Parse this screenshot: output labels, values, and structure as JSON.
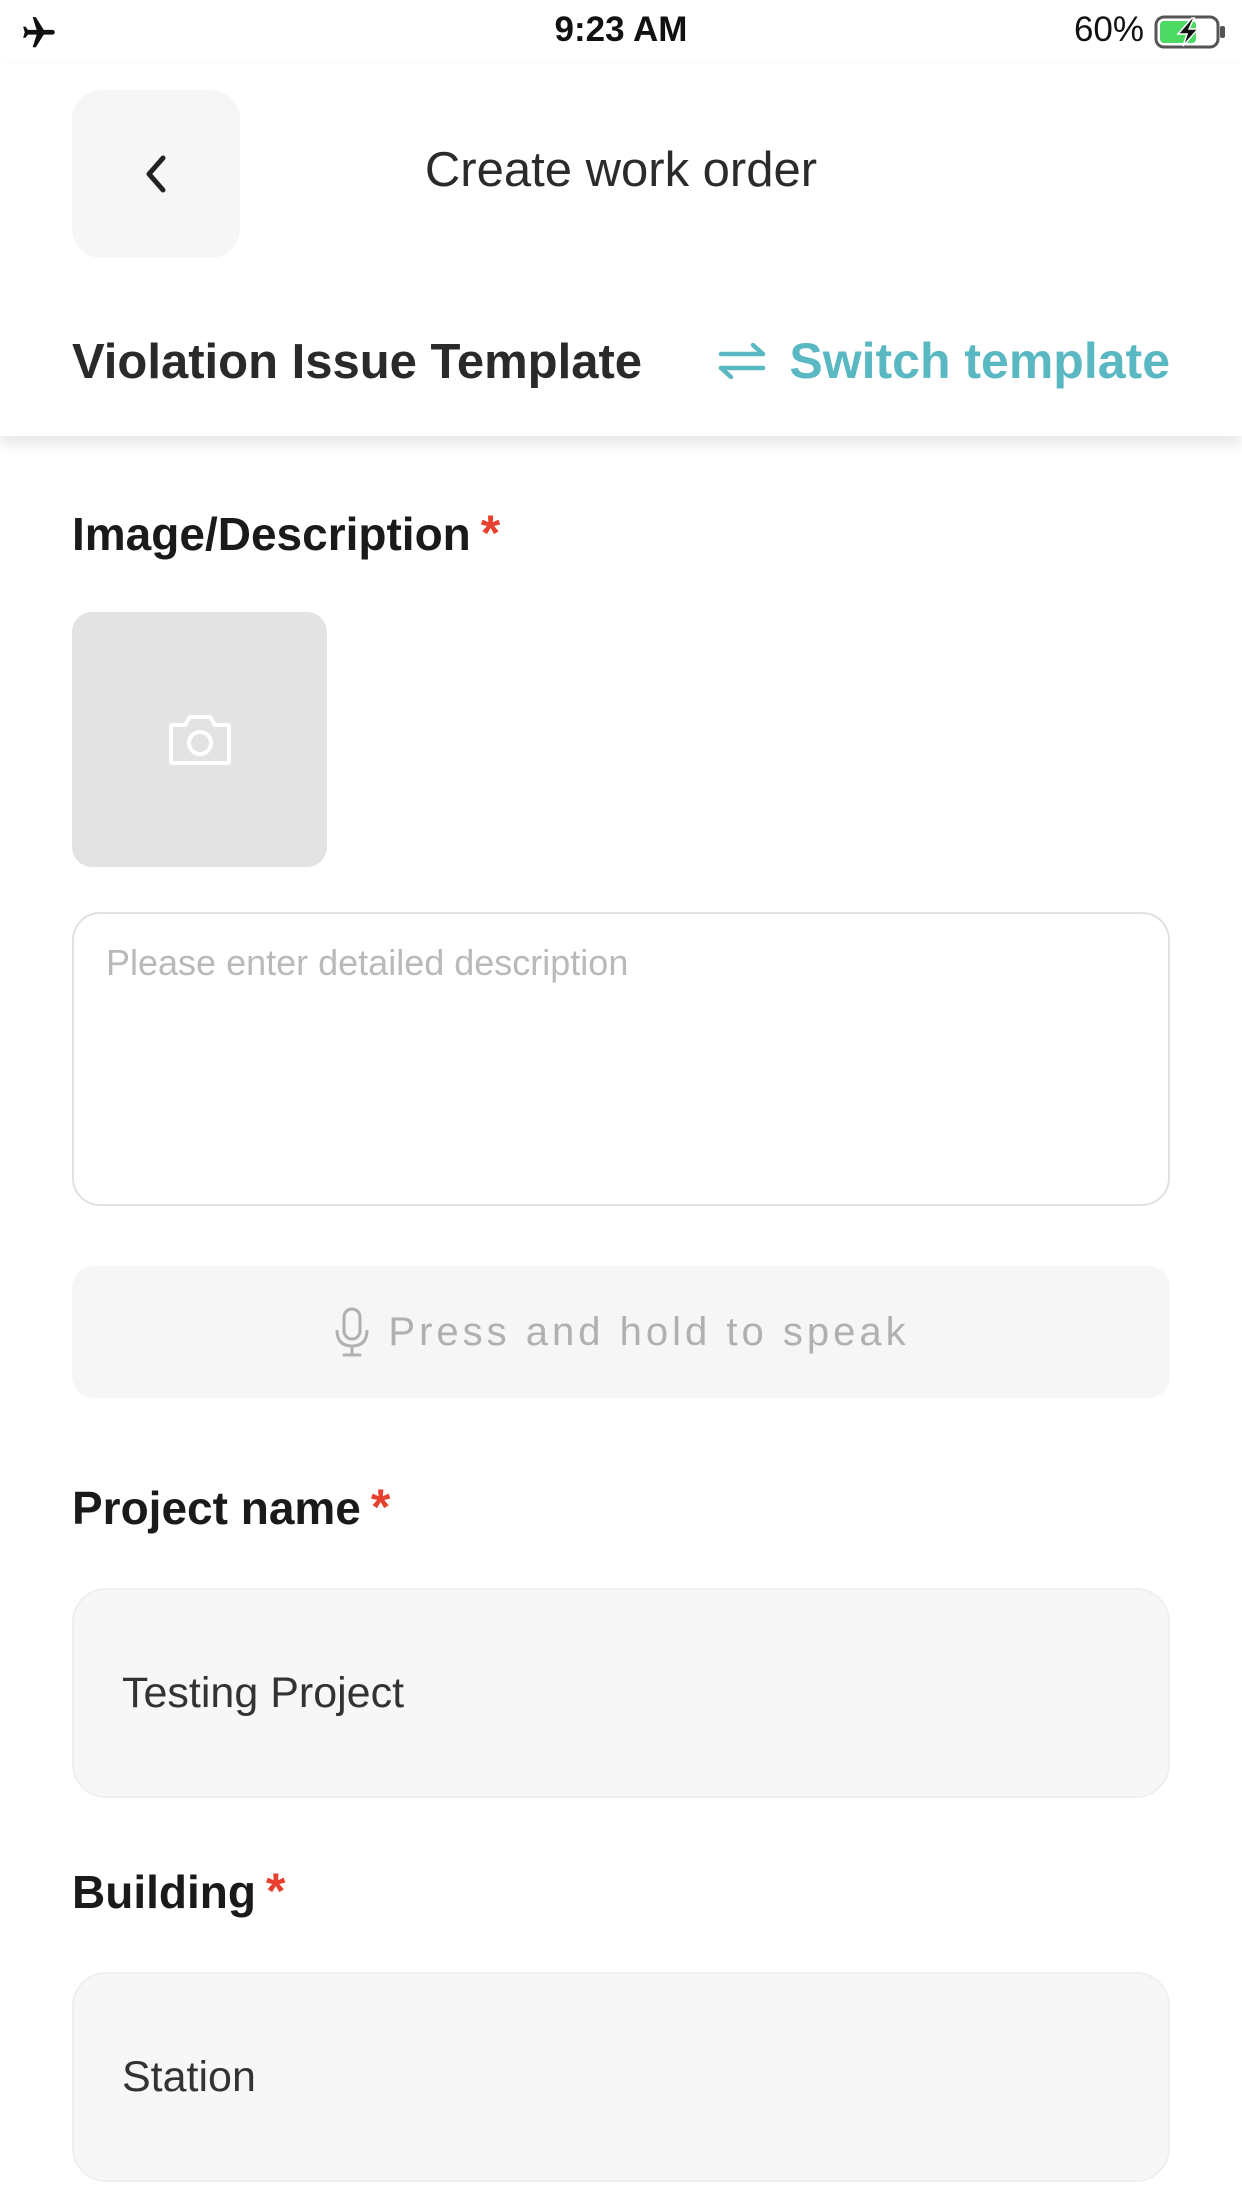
{
  "status_bar": {
    "time": "9:23 AM",
    "battery_percent": "60%",
    "airplane_icon": "airplane-icon",
    "battery_icon": "battery-charging-icon"
  },
  "header": {
    "title": "Create work order",
    "back_icon": "chevron-left-icon",
    "template_name": "Violation Issue Template",
    "switch_template_label": "Switch template",
    "switch_icon": "swap-arrows-icon"
  },
  "form": {
    "image_description": {
      "label": "Image/Description",
      "required_mark": "*",
      "camera_icon": "camera-icon",
      "description_placeholder": "Please enter detailed description",
      "description_value": ""
    },
    "voice": {
      "label": "Press and hold to speak",
      "icon": "microphone-icon"
    },
    "project_name": {
      "label": "Project name",
      "required_mark": "*",
      "value": "Testing Project"
    },
    "building": {
      "label": "Building",
      "required_mark": "*",
      "value": "Station"
    }
  },
  "colors": {
    "accent": "#5ab8c3",
    "required": "#e8402e",
    "field_background": "#f7f7f7"
  }
}
